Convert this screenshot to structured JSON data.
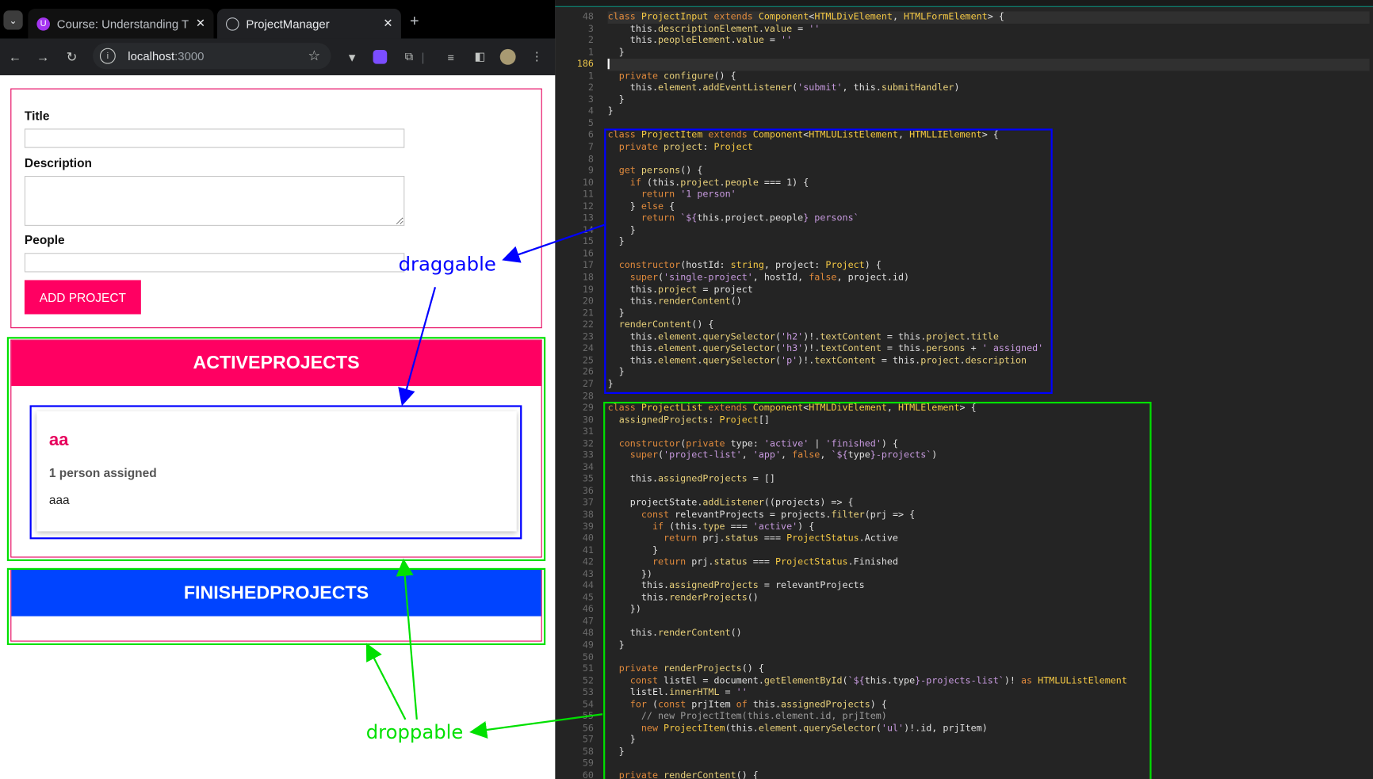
{
  "browser": {
    "tabs": [
      {
        "label": "Course: Understanding T",
        "favicon": "udemy-icon",
        "active": false
      },
      {
        "label": "ProjectManager",
        "favicon": "globe-icon",
        "active": true
      }
    ],
    "url_host": "localhost",
    "url_port": ":3000"
  },
  "form": {
    "title_label": "Title",
    "title_value": "",
    "description_label": "Description",
    "description_value": "",
    "people_label": "People",
    "people_value": "",
    "submit_label": "ADD PROJECT"
  },
  "lists": {
    "active_header": "ACTIVEPROJECTS",
    "finished_header": "FINISHEDPROJECTS",
    "active_color": "#ff0062",
    "finished_color": "#0044ff"
  },
  "project_card": {
    "title": "aa",
    "assigned": "1 person assigned",
    "description": "aaa"
  },
  "annotations": {
    "draggable": "draggable",
    "droppable": "droppable"
  },
  "editor": {
    "current_line": "186",
    "line_numbers": [
      "48",
      "3",
      "2",
      "1",
      "186",
      "1",
      "2",
      "3",
      "4",
      "5",
      "6",
      "7",
      "8",
      "9",
      "10",
      "11",
      "12",
      "13",
      "14",
      "15",
      "16",
      "17",
      "18",
      "19",
      "20",
      "21",
      "22",
      "23",
      "24",
      "25",
      "26",
      "27",
      "28",
      "29",
      "30",
      "31",
      "32",
      "33",
      "34",
      "35",
      "36",
      "37",
      "38",
      "39",
      "40",
      "41",
      "42",
      "43",
      "44",
      "45",
      "46",
      "47",
      "48",
      "49",
      "50",
      "51",
      "52",
      "53",
      "54",
      "55",
      "56",
      "57",
      "58",
      "59",
      "60"
    ],
    "lines": [
      [
        [
          "k",
          "class "
        ],
        [
          "t",
          "ProjectInput "
        ],
        [
          "k",
          "extends "
        ],
        [
          "t",
          "Component"
        ],
        [
          "",
          "<"
        ],
        [
          "t",
          "HTMLDivElement"
        ],
        [
          "",
          ", "
        ],
        [
          "t",
          "HTMLFormElement"
        ],
        [
          "",
          "> {"
        ]
      ],
      [
        [
          "",
          "    this."
        ],
        [
          "f",
          "descriptionElement"
        ],
        [
          "",
          "."
        ],
        [
          "f",
          "value"
        ],
        [
          "",
          " = "
        ],
        [
          "s",
          "''"
        ]
      ],
      [
        [
          "",
          "    this."
        ],
        [
          "f",
          "peopleElement"
        ],
        [
          "",
          "."
        ],
        [
          "f",
          "value"
        ],
        [
          "",
          " = "
        ],
        [
          "s",
          "''"
        ]
      ],
      [
        [
          "",
          "  }"
        ]
      ],
      [
        [
          "",
          ""
        ]
      ],
      [
        [
          "",
          "  "
        ],
        [
          "k",
          "private "
        ],
        [
          "f",
          "configure"
        ],
        [
          "",
          "() {"
        ]
      ],
      [
        [
          "",
          "    this."
        ],
        [
          "f",
          "element"
        ],
        [
          "",
          "."
        ],
        [
          "f",
          "addEventListener"
        ],
        [
          "",
          "("
        ],
        [
          "s",
          "'submit'"
        ],
        [
          "",
          ", this."
        ],
        [
          "f",
          "submitHandler"
        ],
        [
          "",
          ")"
        ]
      ],
      [
        [
          "",
          "  }"
        ]
      ],
      [
        [
          "",
          "}"
        ]
      ],
      [
        [
          "",
          ""
        ]
      ],
      [
        [
          "k",
          "class "
        ],
        [
          "t",
          "ProjectItem "
        ],
        [
          "k",
          "extends "
        ],
        [
          "t",
          "Component"
        ],
        [
          "",
          "<"
        ],
        [
          "t",
          "HTMLUListElement"
        ],
        [
          "",
          ", "
        ],
        [
          "t",
          "HTMLLIElement"
        ],
        [
          "",
          "> {"
        ]
      ],
      [
        [
          "",
          "  "
        ],
        [
          "k",
          "private "
        ],
        [
          "f",
          "project"
        ],
        [
          "",
          ": "
        ],
        [
          "t",
          "Project"
        ]
      ],
      [
        [
          "",
          ""
        ]
      ],
      [
        [
          "",
          "  "
        ],
        [
          "k",
          "get "
        ],
        [
          "f",
          "persons"
        ],
        [
          "",
          "() {"
        ]
      ],
      [
        [
          "",
          "    "
        ],
        [
          "k",
          "if "
        ],
        [
          "",
          "(this."
        ],
        [
          "f",
          "project"
        ],
        [
          "",
          "."
        ],
        [
          "f",
          "people"
        ],
        [
          "",
          " === 1) {"
        ]
      ],
      [
        [
          "",
          "      "
        ],
        [
          "k",
          "return "
        ],
        [
          "s",
          "'1 person'"
        ]
      ],
      [
        [
          "",
          "    } "
        ],
        [
          "k",
          "else "
        ],
        [
          "",
          "{"
        ]
      ],
      [
        [
          "",
          "      "
        ],
        [
          "k",
          "return "
        ],
        [
          "s",
          "`${"
        ],
        [
          "",
          "this.project.people"
        ],
        [
          "s",
          "} persons`"
        ]
      ],
      [
        [
          "",
          "    }"
        ]
      ],
      [
        [
          "",
          "  }"
        ]
      ],
      [
        [
          "",
          ""
        ]
      ],
      [
        [
          "",
          "  "
        ],
        [
          "k",
          "constructor"
        ],
        [
          "",
          "(hostId: "
        ],
        [
          "t",
          "string"
        ],
        [
          "",
          ", project: "
        ],
        [
          "t",
          "Project"
        ],
        [
          "",
          ") {"
        ]
      ],
      [
        [
          "",
          "    "
        ],
        [
          "k",
          "super"
        ],
        [
          "",
          "("
        ],
        [
          "s",
          "'single-project'"
        ],
        [
          "",
          ", hostId, "
        ],
        [
          "k",
          "false"
        ],
        [
          "",
          ", project.id)"
        ]
      ],
      [
        [
          "",
          "    this."
        ],
        [
          "f",
          "project"
        ],
        [
          "",
          " = project"
        ]
      ],
      [
        [
          "",
          "    this."
        ],
        [
          "f",
          "renderContent"
        ],
        [
          "",
          "()"
        ]
      ],
      [
        [
          "",
          "  }"
        ]
      ],
      [
        [
          "",
          "  "
        ],
        [
          "f",
          "renderContent"
        ],
        [
          "",
          "() {"
        ]
      ],
      [
        [
          "",
          "    this."
        ],
        [
          "f",
          "element"
        ],
        [
          "",
          "."
        ],
        [
          "f",
          "querySelector"
        ],
        [
          "",
          "("
        ],
        [
          "s",
          "'h2'"
        ],
        [
          "",
          ")!."
        ],
        [
          "f",
          "textContent"
        ],
        [
          "",
          " = this."
        ],
        [
          "f",
          "project"
        ],
        [
          "",
          "."
        ],
        [
          "f",
          "title"
        ]
      ],
      [
        [
          "",
          "    this."
        ],
        [
          "f",
          "element"
        ],
        [
          "",
          "."
        ],
        [
          "f",
          "querySelector"
        ],
        [
          "",
          "("
        ],
        [
          "s",
          "'h3'"
        ],
        [
          "",
          ")!."
        ],
        [
          "f",
          "textContent"
        ],
        [
          "",
          " = this."
        ],
        [
          "f",
          "persons"
        ],
        [
          "",
          " + "
        ],
        [
          "s",
          "' assigned'"
        ]
      ],
      [
        [
          "",
          "    this."
        ],
        [
          "f",
          "element"
        ],
        [
          "",
          "."
        ],
        [
          "f",
          "querySelector"
        ],
        [
          "",
          "("
        ],
        [
          "s",
          "'p'"
        ],
        [
          "",
          ")!."
        ],
        [
          "f",
          "textContent"
        ],
        [
          "",
          " = this."
        ],
        [
          "f",
          "project"
        ],
        [
          "",
          "."
        ],
        [
          "f",
          "description"
        ]
      ],
      [
        [
          "",
          "  }"
        ]
      ],
      [
        [
          "",
          "}"
        ]
      ],
      [
        [
          "",
          ""
        ]
      ],
      [
        [
          "k",
          "class "
        ],
        [
          "t",
          "ProjectList "
        ],
        [
          "k",
          "extends "
        ],
        [
          "t",
          "Component"
        ],
        [
          "",
          "<"
        ],
        [
          "t",
          "HTMLDivElement"
        ],
        [
          "",
          ", "
        ],
        [
          "t",
          "HTMLElement"
        ],
        [
          "",
          "> {"
        ]
      ],
      [
        [
          "",
          "  "
        ],
        [
          "f",
          "assignedProjects"
        ],
        [
          "",
          ": "
        ],
        [
          "t",
          "Project"
        ],
        [
          "",
          "[]"
        ]
      ],
      [
        [
          "",
          ""
        ]
      ],
      [
        [
          "",
          "  "
        ],
        [
          "k",
          "constructor"
        ],
        [
          "",
          "("
        ],
        [
          "k",
          "private "
        ],
        [
          "",
          "type: "
        ],
        [
          "s",
          "'active'"
        ],
        [
          "",
          " | "
        ],
        [
          "s",
          "'finished'"
        ],
        [
          "",
          ") {"
        ]
      ],
      [
        [
          "",
          "    "
        ],
        [
          "k",
          "super"
        ],
        [
          "",
          "("
        ],
        [
          "s",
          "'project-list'"
        ],
        [
          "",
          ", "
        ],
        [
          "s",
          "'app'"
        ],
        [
          "",
          ", "
        ],
        [
          "k",
          "false"
        ],
        [
          "",
          ", "
        ],
        [
          "s",
          "`${"
        ],
        [
          "",
          "type"
        ],
        [
          "s",
          "}-projects`"
        ],
        [
          "",
          ")"
        ]
      ],
      [
        [
          "",
          ""
        ]
      ],
      [
        [
          "",
          "    this."
        ],
        [
          "f",
          "assignedProjects"
        ],
        [
          "",
          " = []"
        ]
      ],
      [
        [
          "",
          ""
        ]
      ],
      [
        [
          "",
          "    projectState."
        ],
        [
          "f",
          "addListener"
        ],
        [
          "",
          "((projects) => {"
        ]
      ],
      [
        [
          "",
          "      "
        ],
        [
          "k",
          "const "
        ],
        [
          "",
          "relevantProjects = projects."
        ],
        [
          "f",
          "filter"
        ],
        [
          "",
          "(prj => {"
        ]
      ],
      [
        [
          "",
          "        "
        ],
        [
          "k",
          "if "
        ],
        [
          "",
          "(this."
        ],
        [
          "f",
          "type"
        ],
        [
          "",
          " === "
        ],
        [
          "s",
          "'active'"
        ],
        [
          "",
          ") {"
        ]
      ],
      [
        [
          "",
          "          "
        ],
        [
          "k",
          "return "
        ],
        [
          "",
          "prj."
        ],
        [
          "f",
          "status"
        ],
        [
          "",
          " === "
        ],
        [
          "t",
          "ProjectStatus"
        ],
        [
          "",
          ".Active"
        ]
      ],
      [
        [
          "",
          "        }"
        ]
      ],
      [
        [
          "",
          "        "
        ],
        [
          "k",
          "return "
        ],
        [
          "",
          "prj."
        ],
        [
          "f",
          "status"
        ],
        [
          "",
          " === "
        ],
        [
          "t",
          "ProjectStatus"
        ],
        [
          "",
          ".Finished"
        ]
      ],
      [
        [
          "",
          "      })"
        ]
      ],
      [
        [
          "",
          "      this."
        ],
        [
          "f",
          "assignedProjects"
        ],
        [
          "",
          " = relevantProjects"
        ]
      ],
      [
        [
          "",
          "      this."
        ],
        [
          "f",
          "renderProjects"
        ],
        [
          "",
          "()"
        ]
      ],
      [
        [
          "",
          "    })"
        ]
      ],
      [
        [
          "",
          ""
        ]
      ],
      [
        [
          "",
          "    this."
        ],
        [
          "f",
          "renderContent"
        ],
        [
          "",
          "()"
        ]
      ],
      [
        [
          "",
          "  }"
        ]
      ],
      [
        [
          "",
          ""
        ]
      ],
      [
        [
          "",
          "  "
        ],
        [
          "k",
          "private "
        ],
        [
          "f",
          "renderProjects"
        ],
        [
          "",
          "() {"
        ]
      ],
      [
        [
          "",
          "    "
        ],
        [
          "k",
          "const "
        ],
        [
          "",
          "listEl = document."
        ],
        [
          "f",
          "getElementById"
        ],
        [
          "",
          "("
        ],
        [
          "s",
          "`${"
        ],
        [
          "",
          "this.type"
        ],
        [
          "s",
          "}-projects-list`"
        ],
        [
          "",
          ")! "
        ],
        [
          "k",
          "as "
        ],
        [
          "t",
          "HTMLUListElement"
        ]
      ],
      [
        [
          "",
          "    listEl."
        ],
        [
          "f",
          "innerHTML"
        ],
        [
          "",
          " = "
        ],
        [
          "s",
          "''"
        ]
      ],
      [
        [
          "",
          "    "
        ],
        [
          "k",
          "for "
        ],
        [
          "",
          "("
        ],
        [
          "k",
          "const "
        ],
        [
          "",
          "prjItem "
        ],
        [
          "k",
          "of "
        ],
        [
          "",
          "this."
        ],
        [
          "f",
          "assignedProjects"
        ],
        [
          "",
          ") {"
        ]
      ],
      [
        [
          "cm",
          "      // new ProjectItem(this.element.id, prjItem)"
        ]
      ],
      [
        [
          "",
          "      "
        ],
        [
          "k",
          "new "
        ],
        [
          "t",
          "ProjectItem"
        ],
        [
          "",
          "(this."
        ],
        [
          "f",
          "element"
        ],
        [
          "",
          "."
        ],
        [
          "f",
          "querySelector"
        ],
        [
          "",
          "("
        ],
        [
          "s",
          "'ul'"
        ],
        [
          "",
          ")!.id, prjItem)"
        ]
      ],
      [
        [
          "",
          "    }"
        ]
      ],
      [
        [
          "",
          "  }"
        ]
      ],
      [
        [
          "",
          ""
        ]
      ],
      [
        [
          "",
          "  "
        ],
        [
          "k",
          "private "
        ],
        [
          "f",
          "renderContent"
        ],
        [
          "",
          "() {"
        ]
      ]
    ]
  }
}
